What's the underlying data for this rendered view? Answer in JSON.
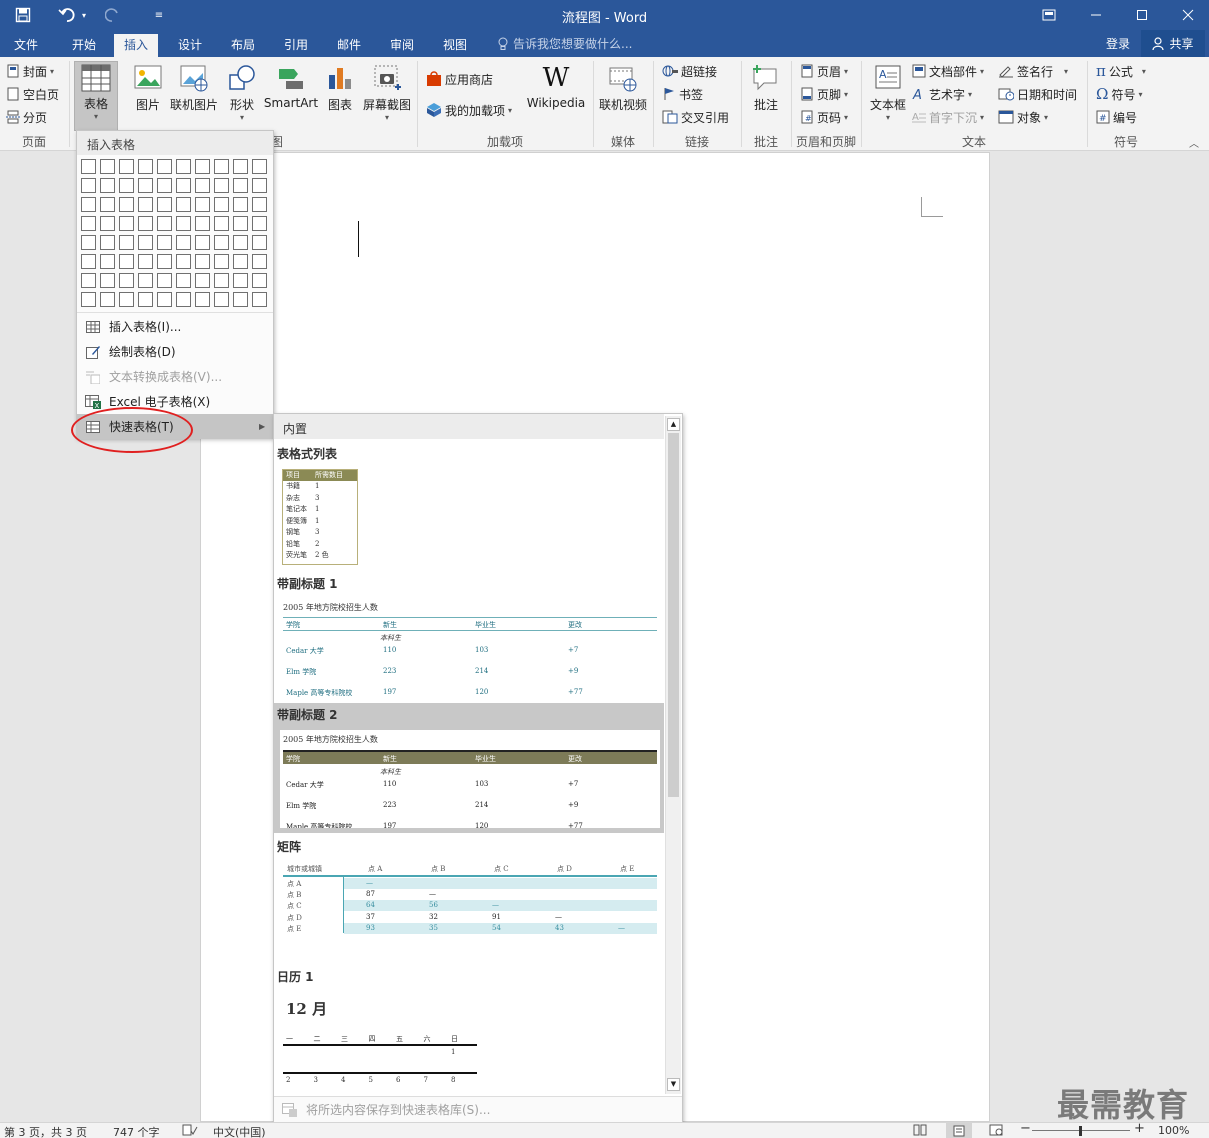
{
  "titlebar": {
    "title": "流程图 - Word"
  },
  "tabs": [
    {
      "label": "文件"
    },
    {
      "label": "开始"
    },
    {
      "label": "插入"
    },
    {
      "label": "设计"
    },
    {
      "label": "布局"
    },
    {
      "label": "引用"
    },
    {
      "label": "邮件"
    },
    {
      "label": "审阅"
    },
    {
      "label": "视图"
    }
  ],
  "tellme": "告诉我您想要做什么...",
  "account": {
    "login": "登录",
    "share": "共享"
  },
  "ribbon": {
    "pages": {
      "cover": "封面",
      "blank": "空白页",
      "break": "分页",
      "group": "页面"
    },
    "table": {
      "label": "表格",
      "group": "表格"
    },
    "illus": {
      "picture": "图片",
      "online_picture": "联机图片",
      "shapes": "形状",
      "smartart": "SmartArt",
      "chart": "图表",
      "screenshot": "屏幕截图",
      "group": "图"
    },
    "addins": {
      "store": "应用商店",
      "myaddins": "我的加载项",
      "wikipedia": "Wikipedia",
      "group": "加载项"
    },
    "media": {
      "video": "联机视频",
      "group": "媒体"
    },
    "links": {
      "hyperlink": "超链接",
      "bookmark": "书签",
      "crossref": "交叉引用",
      "group": "链接"
    },
    "comments": {
      "comment": "批注",
      "group": "批注"
    },
    "headerfooter": {
      "header": "页眉",
      "footer": "页脚",
      "pagenum": "页码",
      "group": "页眉和页脚"
    },
    "text": {
      "textbox": "文本框",
      "quickparts": "文档部件",
      "wordart": "艺术字",
      "dropcap": "首字下沉",
      "signature": "签名行",
      "datetime": "日期和时间",
      "object": "对象",
      "group": "文本"
    },
    "symbols": {
      "equation": "公式",
      "symbol": "符号",
      "number": "编号",
      "group": "符号"
    }
  },
  "dropdown": {
    "header": "插入表格",
    "items": [
      {
        "label": "插入表格(I)..."
      },
      {
        "label": "绘制表格(D)"
      },
      {
        "label": "文本转换成表格(V)..."
      },
      {
        "label": "Excel 电子表格(X)"
      },
      {
        "label": "快速表格(T)"
      }
    ]
  },
  "gallery": {
    "header": "内置",
    "sections": [
      {
        "title": "表格式列表"
      },
      {
        "title": "带副标题 1"
      },
      {
        "title": "带副标题 2"
      },
      {
        "title": "矩阵"
      },
      {
        "title": "日历 1"
      }
    ],
    "footer": "将所选内容保存到快速表格库(S)...",
    "tabular": {
      "headers": [
        "项目",
        "所需数目"
      ],
      "rows": [
        [
          "书籍",
          "1"
        ],
        [
          "杂志",
          "3"
        ],
        [
          "笔记本",
          "1"
        ],
        [
          "便笺簿",
          "1"
        ],
        [
          "钢笔",
          "3"
        ],
        [
          "铅笔",
          "2"
        ],
        [
          "荧光笔",
          "2 色"
        ]
      ]
    },
    "sub1": {
      "title": "2005 年地方院校招生人数",
      "headers": [
        "学院",
        "新生",
        "毕业生",
        "更改"
      ],
      "subhead": "本科生",
      "rows": [
        [
          "Cedar 大学",
          "110",
          "103",
          "+7"
        ],
        [
          "Elm 学院",
          "223",
          "214",
          "+9"
        ],
        [
          "Maple 高等专科院校",
          "197",
          "120",
          "+77"
        ]
      ]
    },
    "sub2": {
      "title": "2005 年地方院校招生人数",
      "headers": [
        "学院",
        "新生",
        "毕业生",
        "更改"
      ],
      "subhead": "本科生",
      "rows": [
        [
          "Cedar 大学",
          "110",
          "103",
          "+7"
        ],
        [
          "Elm 学院",
          "223",
          "214",
          "+9"
        ],
        [
          "Maple 高等专科院校",
          "197",
          "120",
          "+77"
        ]
      ]
    },
    "matrix": {
      "headers": [
        "城市或城镇",
        "点 A",
        "点 B",
        "点 C",
        "点 D",
        "点 E"
      ],
      "rows": [
        [
          "点 A",
          "—",
          "",
          "",
          "",
          ""
        ],
        [
          "点 B",
          "87",
          "—",
          "",
          "",
          ""
        ],
        [
          "点 C",
          "64",
          "56",
          "—",
          "",
          ""
        ],
        [
          "点 D",
          "37",
          "32",
          "91",
          "—",
          ""
        ],
        [
          "点 E",
          "93",
          "35",
          "54",
          "43",
          "—"
        ]
      ]
    },
    "calendar": {
      "month": "12 月",
      "days": [
        "一",
        "二",
        "三",
        "四",
        "五",
        "六",
        "日"
      ],
      "row1": [
        "",
        "",
        "",
        "",
        "",
        "",
        "1"
      ],
      "row2": [
        "2",
        "3",
        "4",
        "5",
        "6",
        "7",
        "8"
      ]
    }
  },
  "status": {
    "page": "第 3 页，共 3 页",
    "words": "747 个字",
    "lang": "中文(中国)",
    "zoom": "100%"
  },
  "watermark": "最需教育"
}
